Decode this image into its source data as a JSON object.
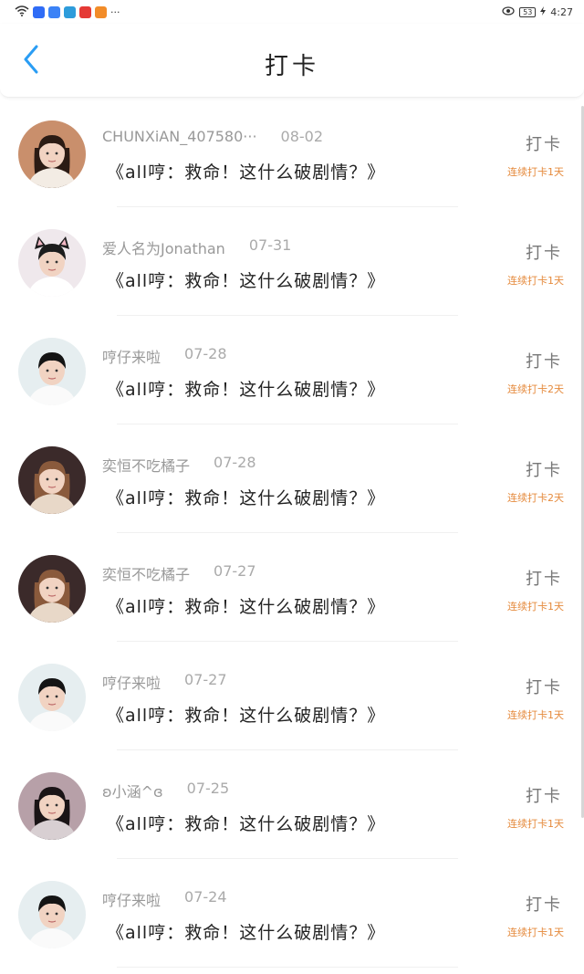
{
  "status_bar": {
    "overflow": "···",
    "battery": "53",
    "time": "4:27",
    "app_colors": [
      "#2f6cf6",
      "#3b82f6",
      "#2d9cdb",
      "#e53935",
      "#f28c28"
    ]
  },
  "header": {
    "title": "打卡",
    "back_icon": "chevron-left-icon",
    "accent": "#2a9df4"
  },
  "list": [
    {
      "name": "CHUNXiAN_407580···",
      "date": "08-02",
      "book": "《all哼：救命！这什么破剧情？》",
      "checkin": "打卡",
      "streak": "连续打卡1天",
      "avatar": "girl-portrait"
    },
    {
      "name": "爱人名为Jonathan",
      "date": "07-31",
      "book": "《all哼：救命！这什么破剧情？》",
      "checkin": "打卡",
      "streak": "连续打卡1天",
      "avatar": "boy-cat-ears"
    },
    {
      "name": "哼仔来啦",
      "date": "07-28",
      "book": "《all哼：救命！这什么破剧情？》",
      "checkin": "打卡",
      "streak": "连续打卡2天",
      "avatar": "boy-white-shirt"
    },
    {
      "name": "奕恒不吃橘子",
      "date": "07-28",
      "book": "《all哼：救命！这什么破剧情？》",
      "checkin": "打卡",
      "streak": "连续打卡2天",
      "avatar": "girl-long-hair"
    },
    {
      "name": "奕恒不吃橘子",
      "date": "07-27",
      "book": "《all哼：救命！这什么破剧情？》",
      "checkin": "打卡",
      "streak": "连续打卡1天",
      "avatar": "girl-long-hair"
    },
    {
      "name": "哼仔来啦",
      "date": "07-27",
      "book": "《all哼：救命！这什么破剧情？》",
      "checkin": "打卡",
      "streak": "连续打卡1天",
      "avatar": "boy-white-shirt"
    },
    {
      "name": "ʚ小涵^ɞ",
      "date": "07-25",
      "book": "《all哼：救命！这什么破剧情？》",
      "checkin": "打卡",
      "streak": "连续打卡1天",
      "avatar": "girl-dark-hair"
    },
    {
      "name": "哼仔来啦",
      "date": "07-24",
      "book": "《all哼：救命！这什么破剧情？》",
      "checkin": "打卡",
      "streak": "连续打卡1天",
      "avatar": "boy-white-shirt"
    }
  ]
}
